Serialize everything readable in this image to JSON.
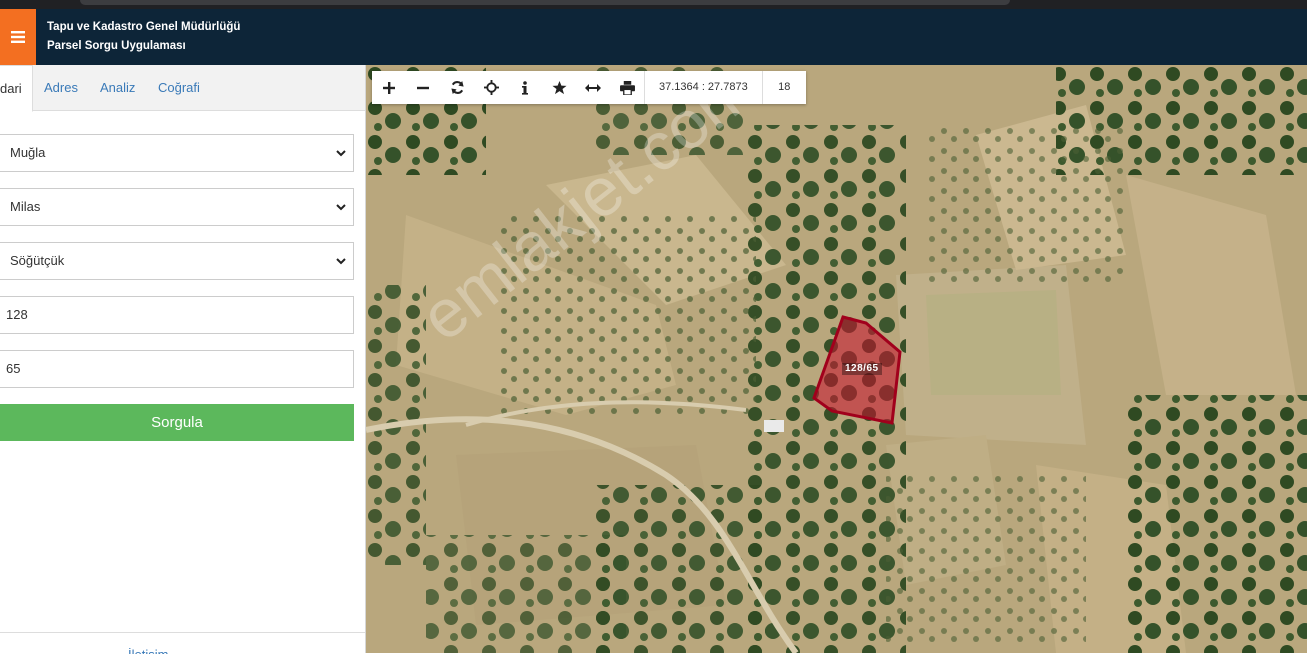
{
  "header": {
    "title_line1": "Tapu ve Kadastro Genel Müdürlüğü",
    "title_line2": "Parsel Sorgu Uygulaması"
  },
  "tabs": [
    {
      "label": "dari",
      "active": true
    },
    {
      "label": "Adres",
      "active": false
    },
    {
      "label": "Analiz",
      "active": false
    },
    {
      "label": "Coğrafi",
      "active": false
    }
  ],
  "form": {
    "province": "Muğla",
    "district": "Milas",
    "neighborhood": "Söğütçük",
    "block": "128",
    "parcel": "65",
    "query_label": "Sorgula"
  },
  "footer_text": "İletişim",
  "toolbar": {
    "coordinates": "37.1364 : 27.7873",
    "zoom_level": "18",
    "icons": [
      "zoom-in-icon",
      "zoom-out-icon",
      "refresh-icon",
      "locate-icon",
      "info-icon",
      "favorite-star-icon",
      "measure-icon",
      "print-icon"
    ]
  },
  "map": {
    "parcel_label": "128/65",
    "watermark": "emlakjet.com",
    "parcel_color": "#c8102e"
  },
  "colors": {
    "header_bg": "#0d2538",
    "menu_accent": "#f36f21",
    "query_button": "#5cb85c",
    "link": "#3a7ab8"
  }
}
